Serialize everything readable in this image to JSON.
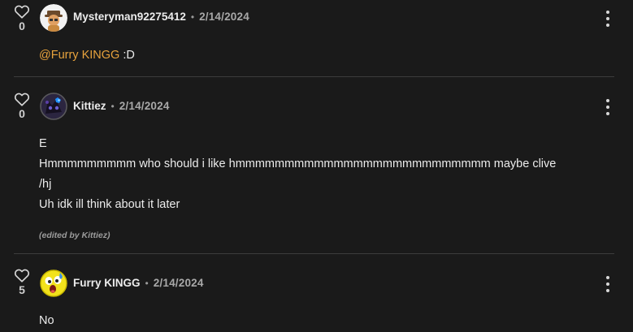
{
  "comments": [
    {
      "likes": "0",
      "username": "Mysteryman92275412",
      "separator": "•",
      "date": "2/14/2024",
      "mention": "@Furry KINGG",
      "text_after_mention": " :D"
    },
    {
      "likes": "0",
      "username": "Kittiez",
      "separator": "•",
      "date": "2/14/2024",
      "lines": [
        "E",
        "Hmmmmmmmmm who should i like hmmmmmmmmmmmmmmmmmmmmmmmmmm maybe clive",
        "/hj",
        "Uh idk ill think about it later"
      ],
      "edited_note": "(edited by Kittiez)"
    },
    {
      "likes": "5",
      "username": "Furry KINGG",
      "separator": "•",
      "date": "2/14/2024",
      "text": "No"
    }
  ],
  "icons": {
    "like": "heart-outline-icon",
    "menu": "kebab-menu-icon"
  },
  "colors": {
    "background": "#1a1a1a",
    "mention": "#e8a33d",
    "divider": "#3c3c3c"
  }
}
